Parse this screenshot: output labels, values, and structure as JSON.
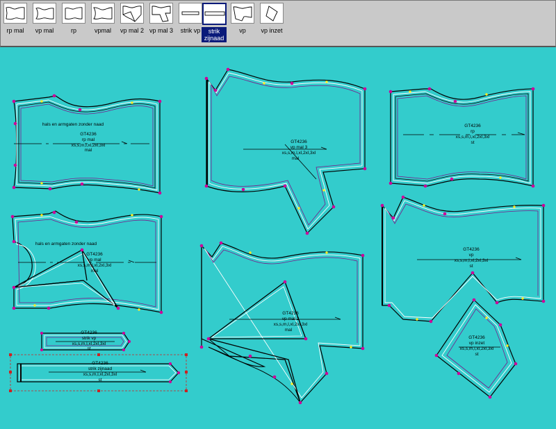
{
  "toolbar": {
    "items": [
      {
        "label": "rp mal",
        "icon": "pattern-piece-icon"
      },
      {
        "label": "vp mal",
        "icon": "pattern-piece-icon"
      },
      {
        "label": "rp",
        "icon": "pattern-piece-icon"
      },
      {
        "label": "vpmal",
        "icon": "pattern-piece-icon"
      },
      {
        "label": "vp mal 2",
        "icon": "pattern-piece-icon"
      },
      {
        "label": "vp mal 3",
        "icon": "pattern-piece-icon"
      },
      {
        "label": "strik vp",
        "icon": "strip-piece-icon"
      },
      {
        "label_line1": "strik",
        "label_line2": "zijnaad",
        "icon": "strip-piece-icon",
        "selected": true
      },
      {
        "label": "vp",
        "icon": "pattern-piece-icon"
      },
      {
        "label": "vp inzet",
        "icon": "inset-piece-icon"
      }
    ]
  },
  "canvas": {
    "background": "#33cccc",
    "outline_colors": {
      "cut": "#000000",
      "seam": "#ffffff",
      "guide": "#7a1a8a"
    },
    "marker_colors": {
      "notch": "#cc0099",
      "grade": "#ffee22"
    },
    "pieces": [
      {
        "note": "hals en armgaten zonder naad",
        "style": "GT4236",
        "name": "rp mal",
        "sizes": "xs,s,m,l,xl,2xl,3xl",
        "type": "mal"
      },
      {
        "style": "GT4236",
        "name": "vp mal 3",
        "sizes": "xs,s,m,l,xl,2xl,3xl",
        "type": "mal"
      },
      {
        "style": "GT4236",
        "name": "rp",
        "sizes": "xs,s,m,l,xl,2xl,3xl",
        "type": "st"
      },
      {
        "note": "hals en armgaten zonder naad",
        "style": "GT4236",
        "name": "vp mal",
        "sizes": "xs,s,m,l,xl,2xl,3xl",
        "type": "mal"
      },
      {
        "style": "GT4236",
        "name": "vp mal 2",
        "sizes": "xs,s,m,l,xl,2xl,3xl",
        "type": "mal"
      },
      {
        "style": "GT4236",
        "name": "vp",
        "sizes": "xs,s,m,l,xl,2xl,3xl",
        "type": "st"
      },
      {
        "style": "GT4236",
        "name": "strik vp",
        "sizes": "xs,s,m,l,xl,2xl,3xl",
        "type": "st"
      },
      {
        "style": "GT4236",
        "name": "strik zijnaad",
        "sizes": "xs,s,m,l,xl,2xl,3xl",
        "type": "st"
      },
      {
        "style": "GT4236",
        "name": "vp inzet",
        "sizes": "xs,s,m,l,xl,2xl,3xl",
        "type": "st"
      }
    ]
  }
}
